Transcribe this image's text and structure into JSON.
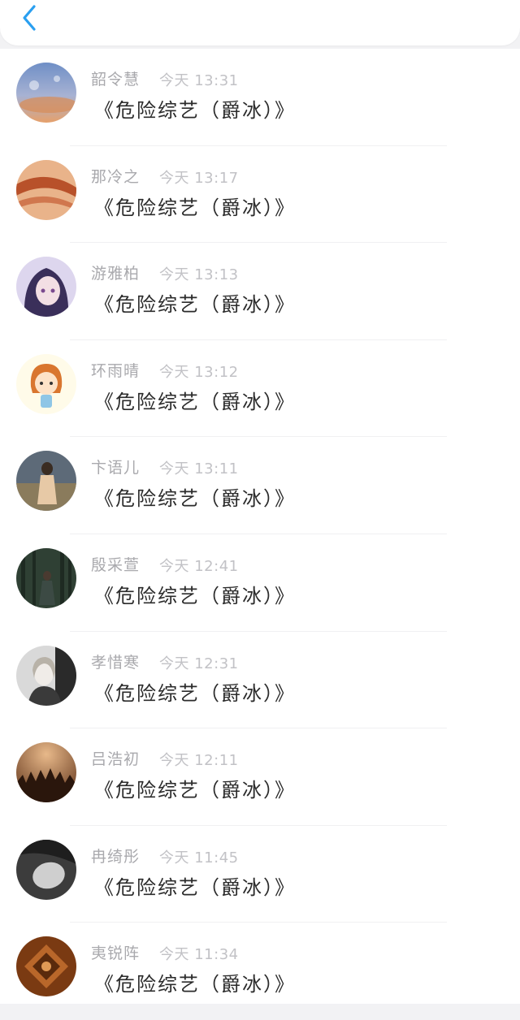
{
  "header": {
    "back_icon": "chevron-left-icon",
    "accent_color": "#2a9ff0"
  },
  "messages": [
    {
      "name": "韶令慧",
      "time": "今天 13:31",
      "text": "《危险综艺（爵冰）》",
      "avatar": "sky-sunset-avatar"
    },
    {
      "name": "那冷之",
      "time": "今天 13:17",
      "text": "《危险综艺（爵冰）》",
      "avatar": "abstract-orange-avatar"
    },
    {
      "name": "游雅柏",
      "time": "今天 13:13",
      "text": "《危险综艺（爵冰）》",
      "avatar": "anime-girl-avatar"
    },
    {
      "name": "环雨晴",
      "time": "今天 13:12",
      "text": "《危险综艺（爵冰）》",
      "avatar": "cartoon-girl-avatar"
    },
    {
      "name": "卞语儿",
      "time": "今天 13:11",
      "text": "《危险综艺（爵冰）》",
      "avatar": "woman-field-avatar"
    },
    {
      "name": "殷采萱",
      "time": "今天 12:41",
      "text": "《危险综艺（爵冰）》",
      "avatar": "forest-figure-avatar"
    },
    {
      "name": "孝惜寒",
      "time": "今天 12:31",
      "text": "《危险综艺（爵冰）》",
      "avatar": "woman-bw-avatar"
    },
    {
      "name": "吕浩初",
      "time": "今天 12:11",
      "text": "《危险综艺（爵冰）》",
      "avatar": "concert-crowd-avatar"
    },
    {
      "name": "冉绮彤",
      "time": "今天 11:45",
      "text": "《危险综艺（爵冰）》",
      "avatar": "face-bw-avatar"
    },
    {
      "name": "夷锐阵",
      "time": "今天 11:34",
      "text": "《危险综艺（爵冰）》",
      "avatar": "emblem-avatar"
    }
  ]
}
